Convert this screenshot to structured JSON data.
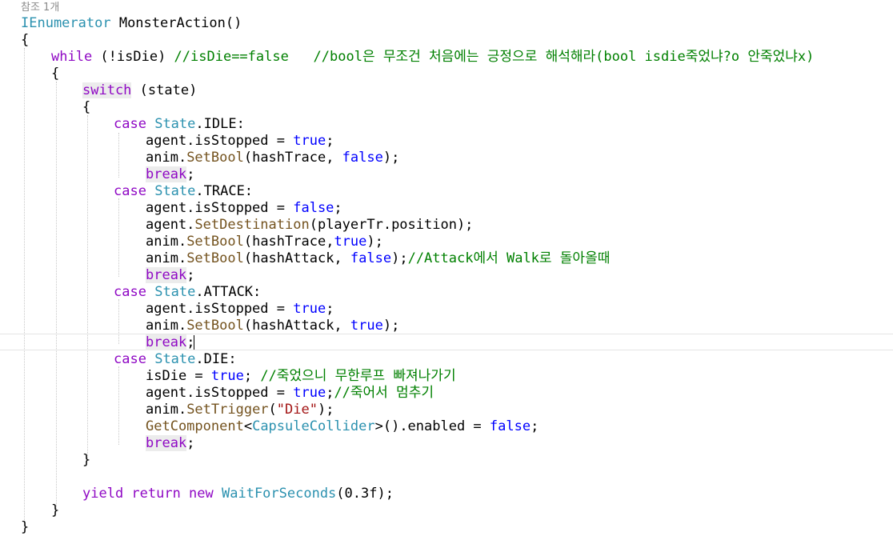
{
  "editor": {
    "ref_hint": "참조 1개",
    "lines": {
      "l1_type": "IEnumerator",
      "l1_name": " MonsterAction()",
      "l2": "{",
      "l3_kw": "while",
      "l3_code": " (!isDie) ",
      "l3_cmt": "//isDie==false   //bool은 무조건 처음에는 긍정으로 해석해라(bool isdie죽었냐?o 안죽었냐x)",
      "l4": "{",
      "l5_kw": "switch",
      "l5_code": " (state)",
      "l6": "{",
      "case_kw": "case",
      "state_type": "State",
      "l7_member": ".IDLE:",
      "l8_code": "agent.isStopped = ",
      "true": "true",
      "false": "false",
      "semi": ";",
      "anim": "anim.",
      "setbool": "SetBool",
      "l9_args": "(hashTrace, ",
      "close_semi": ");",
      "break_kw": "break",
      "l11_member": ".TRACE:",
      "l13_agent": "agent.",
      "setdest": "SetDestination",
      "l13_args": "(playerTr.position);",
      "l14_args": "(hashTrace,",
      "l15_args": "(hashAttack, ",
      "l15_close": ");",
      "l15_cmt": "//Attack에서 Walk로 돌아올때",
      "l17_member": ".ATTACK:",
      "l21_member": ".DIE:",
      "l22_code": "isDie = ",
      "l22_cmt": " //죽었으니 무한루프 빠져나가기",
      "l23_cmt": "//죽어서 멈추기",
      "settrigger": "SetTrigger",
      "l24_open": "(",
      "l24_str": "\"Die\"",
      "getcomp": "GetComponent",
      "lt": "<",
      "capsule": "CapsuleCollider",
      "l25_rest": ">().enabled = ",
      "l27": "}",
      "l29_yield": "yield return new ",
      "wfs": "WaitForSeconds",
      "l29_args": "(0.3f);",
      "l30": "}",
      "l31": "}"
    }
  }
}
